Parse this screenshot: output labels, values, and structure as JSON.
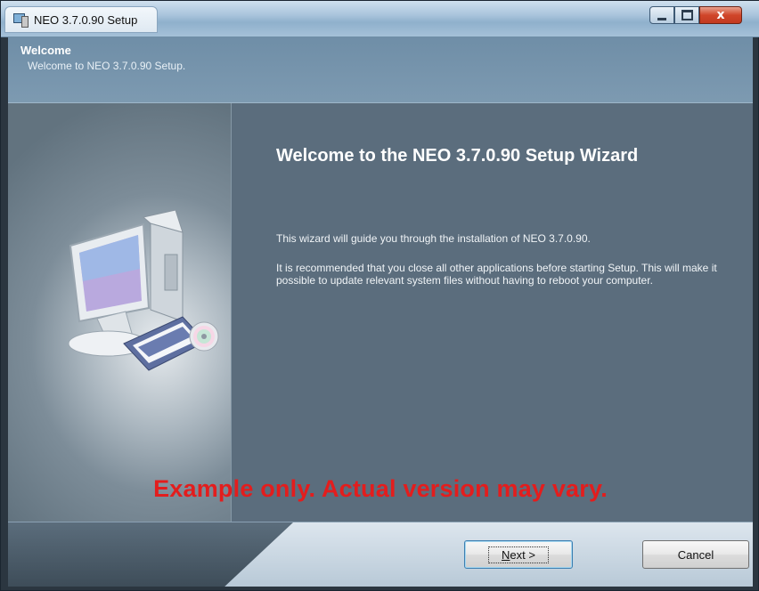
{
  "window": {
    "title": "NEO 3.7.0.90 Setup",
    "app_icon": "installer-icon"
  },
  "header": {
    "title": "Welcome",
    "subtitle": "Welcome to NEO 3.7.0.90 Setup."
  },
  "main": {
    "heading": "Welcome to the NEO 3.7.0.90 Setup Wizard",
    "paragraph1": "This wizard will guide you through the installation of NEO 3.7.0.90.",
    "paragraph2": "It is recommended that you close all other applications before starting Setup. This will make it possible to update relevant system files without having to reboot your computer.",
    "illustration": "computer-with-disc-icon"
  },
  "watermark": "Example only. Actual version may vary.",
  "buttons": {
    "next_prefix": "N",
    "next_rest": "ext >",
    "cancel": "Cancel"
  },
  "colors": {
    "watermark": "#e31d1d",
    "close_button": "#c8452a"
  }
}
